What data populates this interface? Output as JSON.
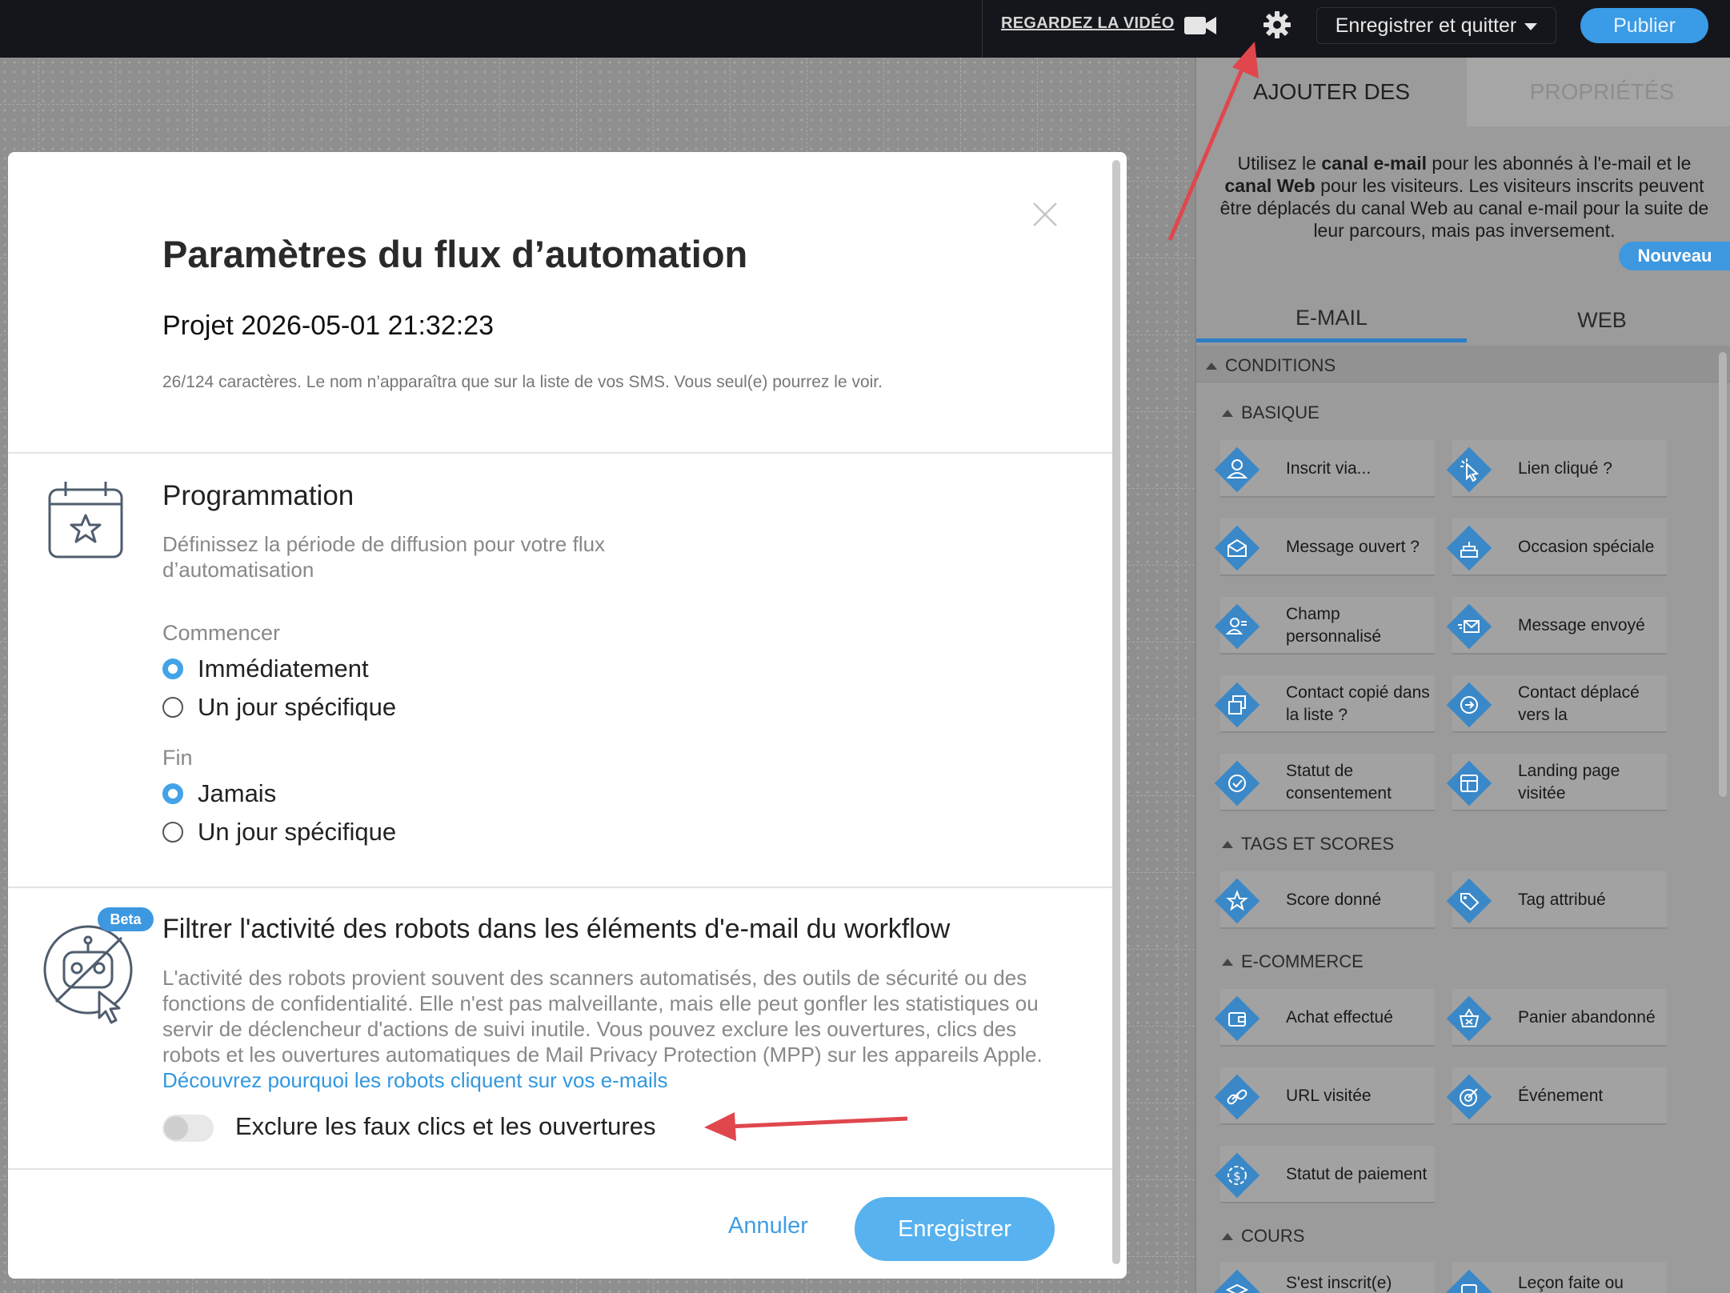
{
  "topbar": {
    "watch_video": "REGARDEZ LA VIDÉO",
    "save_quit": "Enregistrer et quitter",
    "publish": "Publier",
    "icons": [
      "video-camera-icon",
      "gear-icon",
      "chevron-down-icon"
    ]
  },
  "panel": {
    "tab_add": "AJOUTER DES",
    "tab_props": "PROPRIÉTÉS",
    "desc_parts": [
      "Utilisez le ",
      "canal e-mail",
      " pour les abonnés à l'e-mail et le ",
      "canal Web",
      " pour les visiteurs. Les visiteurs inscrits peuvent être déplacés du canal Web au canal e-mail pour la suite de leur parcours, mais pas inversement."
    ],
    "tab_email": "E-MAIL",
    "tab_web": "WEB",
    "new_badge": "Nouveau",
    "conditions": "CONDITIONS",
    "sections": {
      "basique": "BASIQUE",
      "tags": "TAGS ET SCORES",
      "ecommerce": "E-COMMERCE",
      "cours": "COURS"
    },
    "items": {
      "inscrit": "Inscrit via...",
      "lien": "Lien cliqué ?",
      "message_ouvert": "Message ouvert ?",
      "occasion": "Occasion spéciale",
      "champ": "Champ personnalisé",
      "message_envoye": "Message envoyé",
      "contact_copie": "Contact copié dans la liste ?",
      "contact_deplace": "Contact déplacé vers la",
      "statut_consent": "Statut de consentement",
      "landing": "Landing page visitée",
      "score": "Score donné",
      "tag": "Tag attribué",
      "achat": "Achat effectué",
      "panier": "Panier abandonné",
      "url": "URL visitée",
      "evenement": "Événement",
      "statut_paiement": "Statut de paiement",
      "inscrit_cours": "S'est inscrit(e)",
      "lecon": "Leçon faite ou"
    },
    "colors": {
      "diamond": "#3a88c8",
      "accent": "#3d98e0"
    }
  },
  "modal": {
    "title": "Paramètres du flux d’automation",
    "name": "Projet 2026-05-01 21:32:23",
    "hint": "26/124 caractères. Le nom n’apparaîtra que sur la liste de vos SMS. Vous seul(e) pourrez le voir.",
    "schedule": {
      "title": "Programmation",
      "desc": "Définissez la période de diffusion pour votre flux d’automatisation",
      "start_label": "Commencer",
      "start_opt1": "Immédiatement",
      "start_opt2": "Un jour spécifique",
      "end_label": "Fin",
      "end_opt1": "Jamais",
      "end_opt2": "Un jour spécifique"
    },
    "robots": {
      "badge": "Beta",
      "title": "Filtrer l'activité des robots dans les éléments d'e-mail du workflow",
      "desc": "L'activité des robots provient souvent des scanners automatisés, des outils de sécurité ou des fonctions de confidentialité. Elle n'est pas malveillante, mais elle peut gonfler les statistiques ou servir de déclencheur d'actions de suivi inutile. Vous pouvez exclure les ouvertures, clics des robots et les ouvertures automatiques de Mail Privacy Protection (MPP) sur les appareils Apple. ",
      "link": "Découvrez pourquoi les robots cliquent sur vos e-mails",
      "toggle_label": "Exclure les faux clics et les ouvertures"
    },
    "cancel": "Annuler",
    "save": "Enregistrer"
  }
}
